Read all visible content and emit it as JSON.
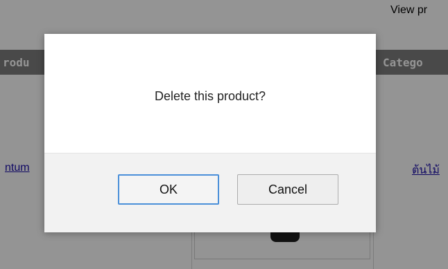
{
  "background": {
    "view_link": "View pr",
    "table_header": {
      "product": "rodu",
      "category": "Catego"
    },
    "left_link": "ntum",
    "right_link": "ต้นไม้"
  },
  "dialog": {
    "message": "Delete this product?",
    "ok_label": "OK",
    "cancel_label": "Cancel"
  },
  "colors": {
    "overlay": "#000000",
    "header_bg": "#7f7f7f",
    "link": "#1a0dab",
    "ok_focus_border": "#4a8fd9"
  }
}
